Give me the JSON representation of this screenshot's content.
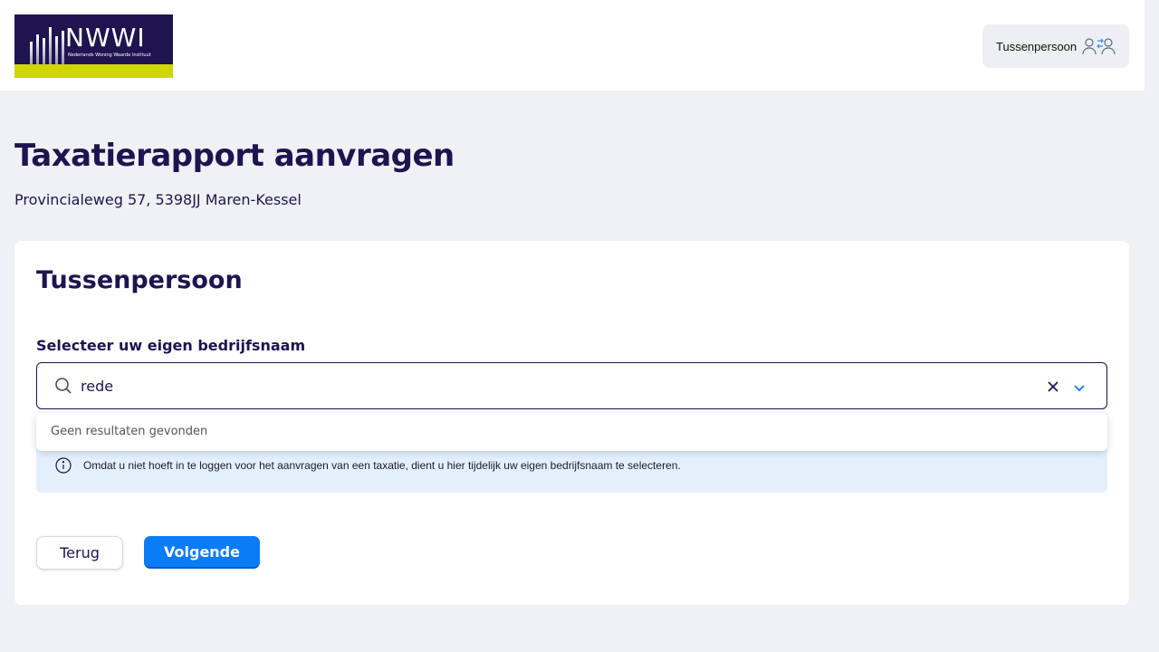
{
  "header": {
    "logo": {
      "brand": "NWWI",
      "tagline": "Nederlands Woning Waarde Instituut",
      "colors": {
        "navy": "#1f1450",
        "lime": "#cfd600"
      }
    },
    "role_chip": {
      "label": "Tussenpersoon",
      "icon": "user-switch-icon"
    }
  },
  "page": {
    "title": "Taxatierapport aanvragen",
    "address": "Provincialeweg 57, 5398JJ Maren-Kessel"
  },
  "card": {
    "title": "Tussenpersoon",
    "field_label": "Selecteer uw eigen bedrijfsnaam",
    "search": {
      "value": "rede",
      "icon": "search-icon"
    },
    "dropdown": {
      "empty_message": "Geen resultaten gevonden"
    },
    "info": {
      "icon": "info-icon",
      "text": "Omdat u niet hoeft in te loggen voor het aanvragen van een taxatie, dient u hier tijdelijk uw eigen bedrijfsnaam te selecteren."
    },
    "buttons": {
      "back": "Terug",
      "next": "Volgende"
    }
  },
  "colors": {
    "primary": "#0a7cf5",
    "text": "#1e1450",
    "background": "#f0f1f5",
    "info_background": "#e3f0fc"
  }
}
